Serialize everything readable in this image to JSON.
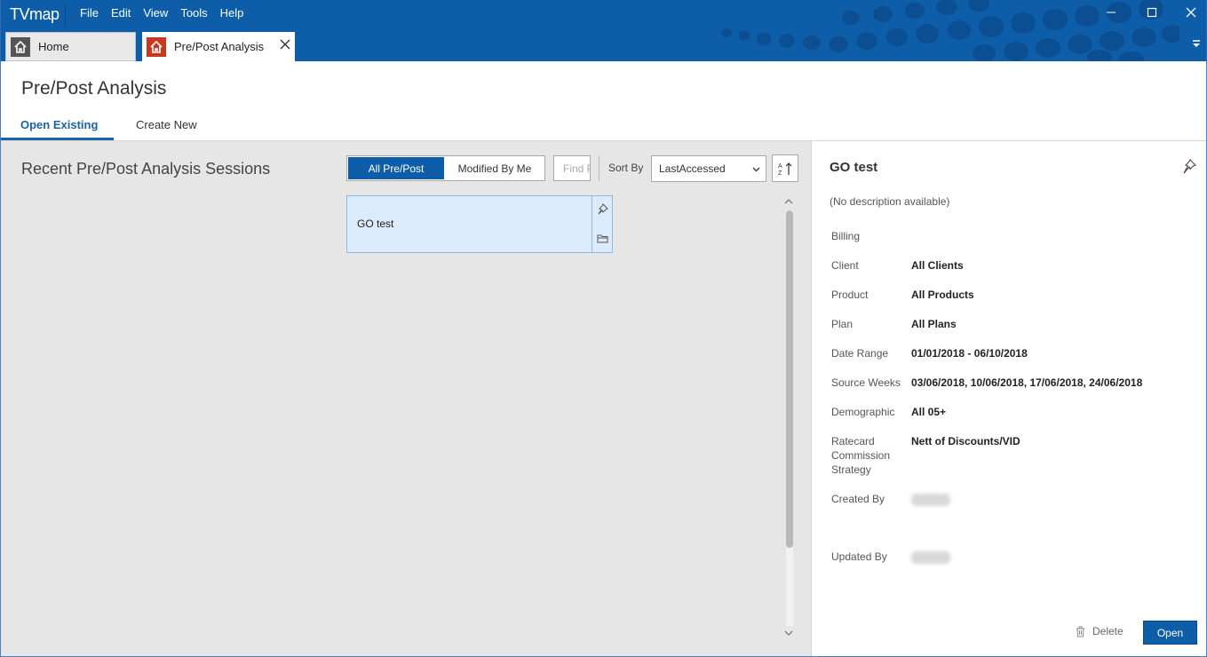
{
  "app": {
    "logo": "TVmap",
    "menu": [
      "File",
      "Edit",
      "View",
      "Tools",
      "Help"
    ],
    "tabs": [
      {
        "label": "Home",
        "icon": "home-icon"
      },
      {
        "label": "Pre/Post Analysis",
        "icon": "home-icon"
      }
    ]
  },
  "page": {
    "title": "Pre/Post Analysis",
    "subtabs": [
      "Open Existing",
      "Create New"
    ],
    "active_subtab": "Open Existing"
  },
  "list": {
    "heading": "Recent Pre/Post Analysis Sessions",
    "filters": [
      "All Pre/Post",
      "Modified By Me"
    ],
    "active_filter": "All Pre/Post",
    "find_placeholder": "Find Pre/Post",
    "sort_label": "Sort By",
    "sort_value": "LastAccessed",
    "items": [
      {
        "title": "GO test"
      }
    ]
  },
  "details": {
    "title": "GO test",
    "description": "(No description available)",
    "fields": [
      {
        "label": "Billing",
        "value": ""
      },
      {
        "label": "Client",
        "value": "All Clients"
      },
      {
        "label": "Product",
        "value": "All Products"
      },
      {
        "label": "Plan",
        "value": "All Plans"
      },
      {
        "label": "Date Range",
        "value": "01/01/2018 - 06/10/2018"
      },
      {
        "label": "Source Weeks",
        "value": "03/06/2018, 10/06/2018, 17/06/2018, 24/06/2018"
      },
      {
        "label": "Demographic",
        "value": "All 05+"
      },
      {
        "label": "Ratecard Commission Strategy",
        "value": "Nett of Discounts/VID"
      },
      {
        "label": "Created By",
        "value": ""
      },
      {
        "label": "Updated By",
        "value": ""
      }
    ],
    "delete_label": "Delete",
    "open_label": "Open"
  },
  "colors": {
    "brand": "#0e5da8",
    "tab_active_icon": "#c83a1e",
    "selected_card": "#dcebfb"
  }
}
